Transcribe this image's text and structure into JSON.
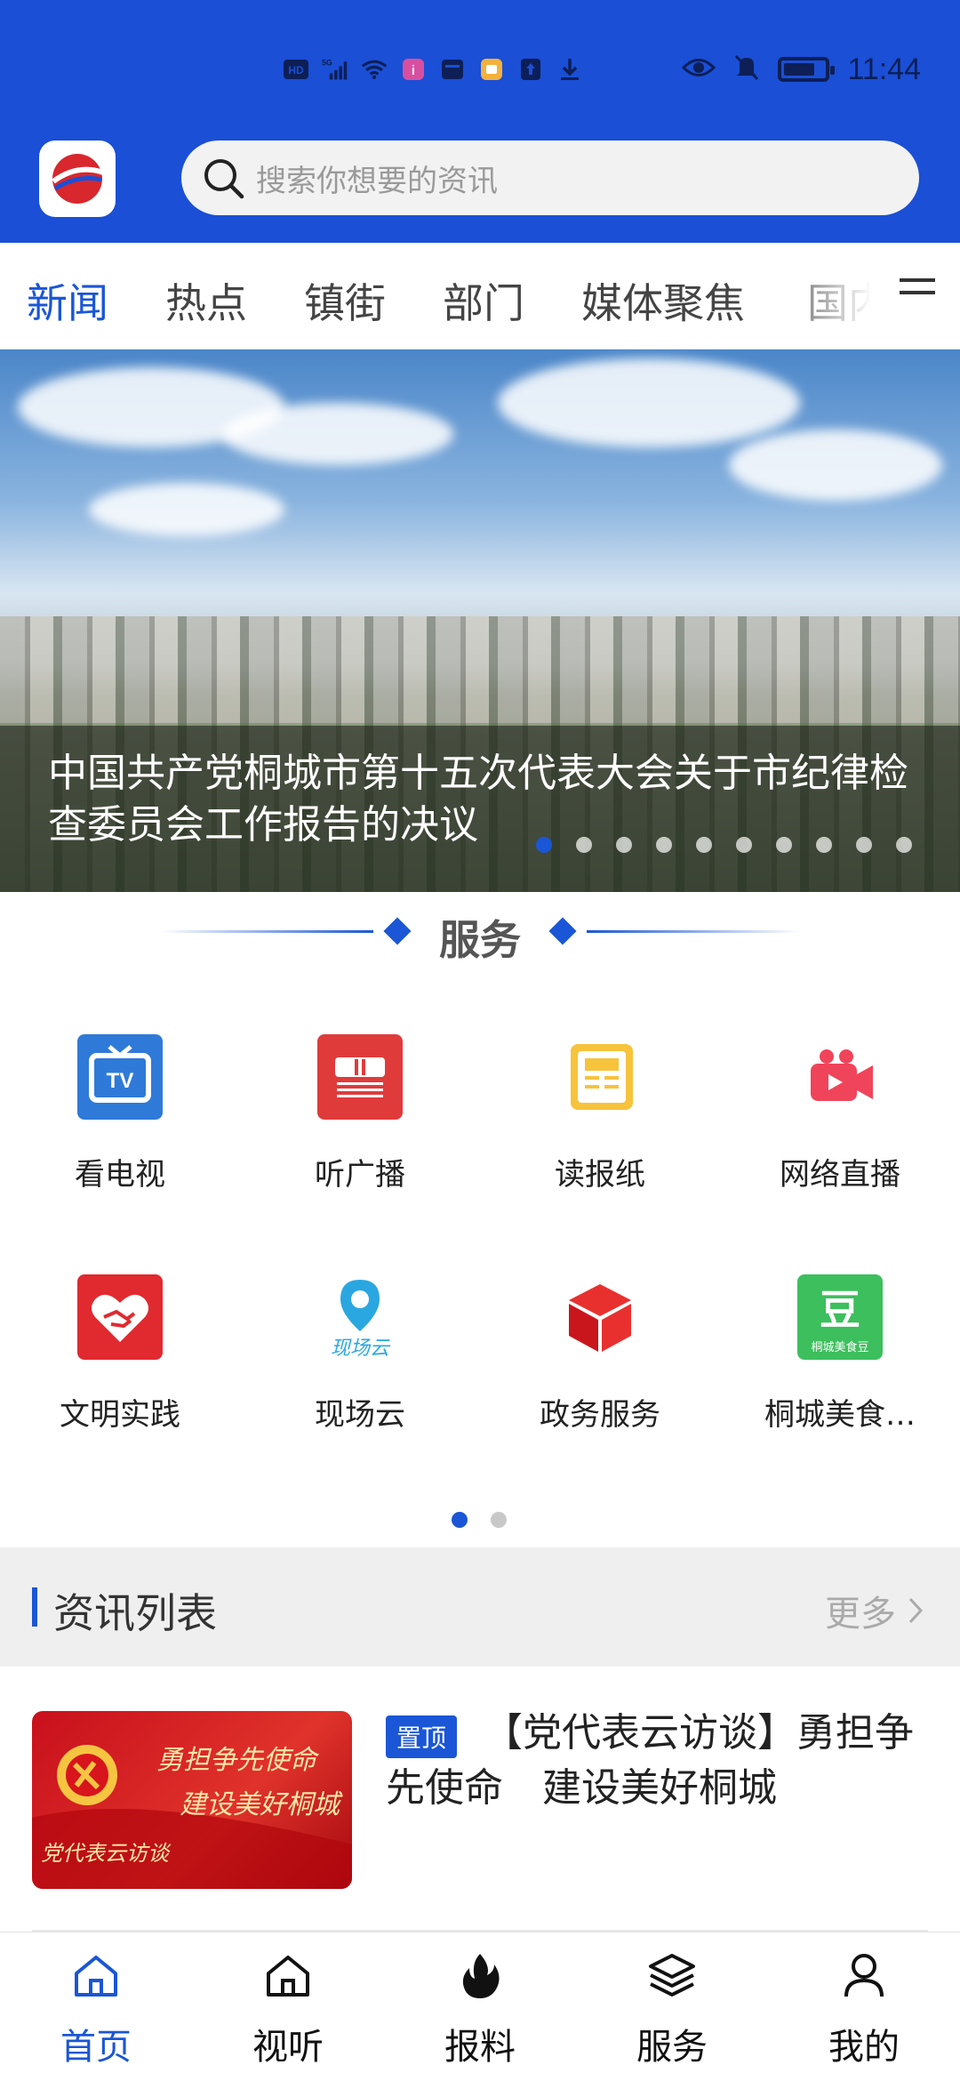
{
  "status_bar": {
    "time": "11:44",
    "left_icons": [
      "hd-icon",
      "signal-5g-icon",
      "wifi-icon",
      "app-notification-icon",
      "message-icon",
      "app-notification-icon-2",
      "upload-icon",
      "download-icon"
    ],
    "right_icons": [
      "eye-icon",
      "mute-icon",
      "battery-icon"
    ],
    "battery_level": 0.8
  },
  "header": {
    "search_placeholder": "搜索你想要的资讯",
    "accent_color": "#1a4fd6"
  },
  "tabs": {
    "items": [
      "新闻",
      "热点",
      "镇街",
      "部门",
      "媒体聚焦",
      "国内"
    ],
    "active_index": 0
  },
  "banner": {
    "caption": "中国共产党桐城市第十五次代表大会关于市纪律检查委员会工作报告的决议",
    "slide_count": 10,
    "active_slide": 0
  },
  "services": {
    "title": "服务",
    "items": [
      {
        "label": "看电视",
        "icon": "tv-icon"
      },
      {
        "label": "听广播",
        "icon": "radio-icon"
      },
      {
        "label": "读报纸",
        "icon": "newspaper-icon"
      },
      {
        "label": "网络直播",
        "icon": "live-camera-icon"
      },
      {
        "label": "文明实践",
        "icon": "heart-handshake-icon"
      },
      {
        "label": "现场云",
        "icon": "scene-cloud-icon",
        "icon_text": "现场云"
      },
      {
        "label": "政务服务",
        "icon": "cube-icon"
      },
      {
        "label": "桐城美食…",
        "icon": "food-bean-icon",
        "icon_text": "豆",
        "icon_subtext": "桐城美食豆"
      }
    ],
    "pages": 2,
    "active_page": 0
  },
  "news_list": {
    "title": "资讯列表",
    "more": "更多",
    "items": [
      {
        "badge": "置顶",
        "title": "【党代表云访谈】勇担争先使命　建设美好桐城",
        "thumb_lines": [
          "勇担争先使命",
          "建设美好桐城",
          "党代表云访谈"
        ]
      }
    ]
  },
  "bottom_nav": {
    "items": [
      {
        "label": "首页",
        "icon": "home-icon"
      },
      {
        "label": "视听",
        "icon": "home-outline-icon"
      },
      {
        "label": "报料",
        "icon": "fire-icon"
      },
      {
        "label": "服务",
        "icon": "layers-icon"
      },
      {
        "label": "我的",
        "icon": "user-icon"
      }
    ],
    "active_index": 0
  }
}
